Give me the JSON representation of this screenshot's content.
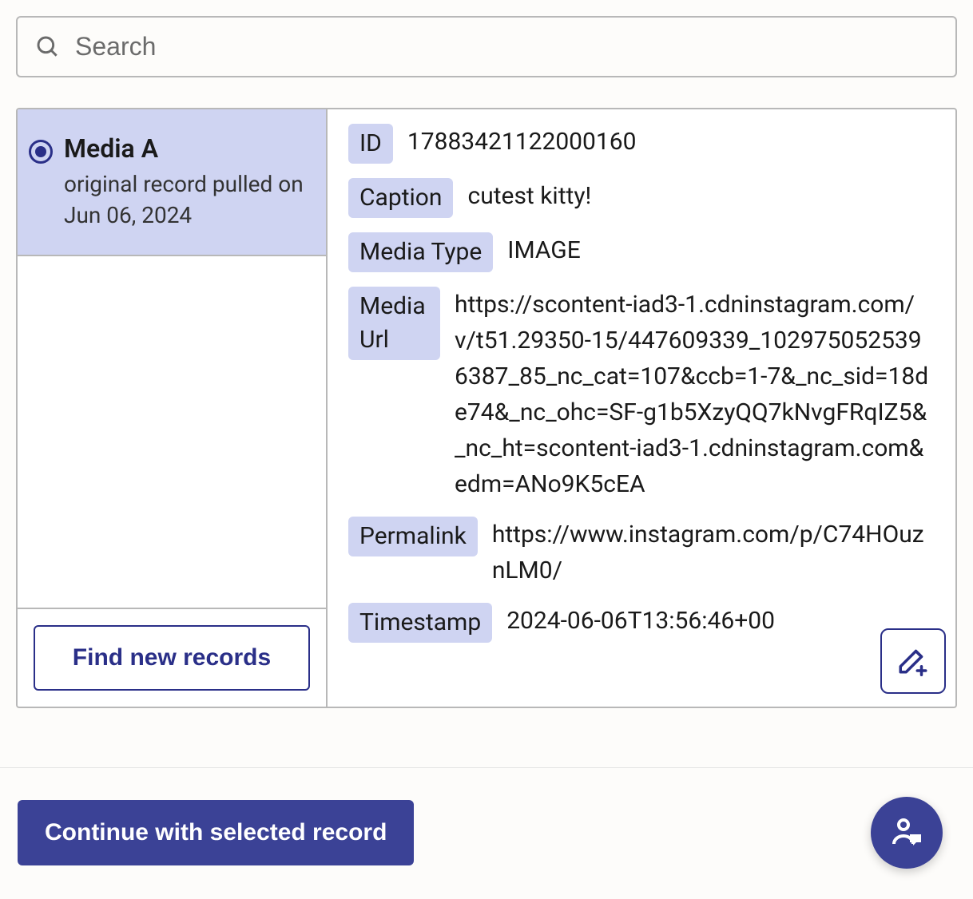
{
  "search": {
    "placeholder": "Search"
  },
  "records": [
    {
      "title": "Media A",
      "subtitle": "original record pulled on Jun 06, 2024",
      "selected": true
    }
  ],
  "left": {
    "find_label": "Find new records"
  },
  "details": {
    "fields": [
      {
        "label": "ID",
        "value": "17883421122000160"
      },
      {
        "label": "Caption",
        "value": "cutest kitty!"
      },
      {
        "label": "Media Type",
        "value": "IMAGE"
      },
      {
        "label": "Media Url",
        "value": "https://scontent-iad3-1.cdninstagram.com/v/t51.29350-15/447609339_1029750525396387_85_nc_cat=107&ccb=1-7&_nc_sid=18de74&_nc_ohc=SF-g1b5XzyQQ7kNvgFRqIZ5&_nc_ht=scontent-iad3-1.cdninstagram.com&edm=ANo9K5cEA"
      },
      {
        "label": "Permalink",
        "value": "https://www.instagram.com/p/C74HOuznLM0/"
      },
      {
        "label": "Timestamp",
        "value": "2024-06-06T13:56:46+00"
      }
    ]
  },
  "bottom": {
    "continue_label": "Continue with selected record"
  },
  "colors": {
    "accent": "#3b4296",
    "label_bg": "#cfd4f2"
  }
}
